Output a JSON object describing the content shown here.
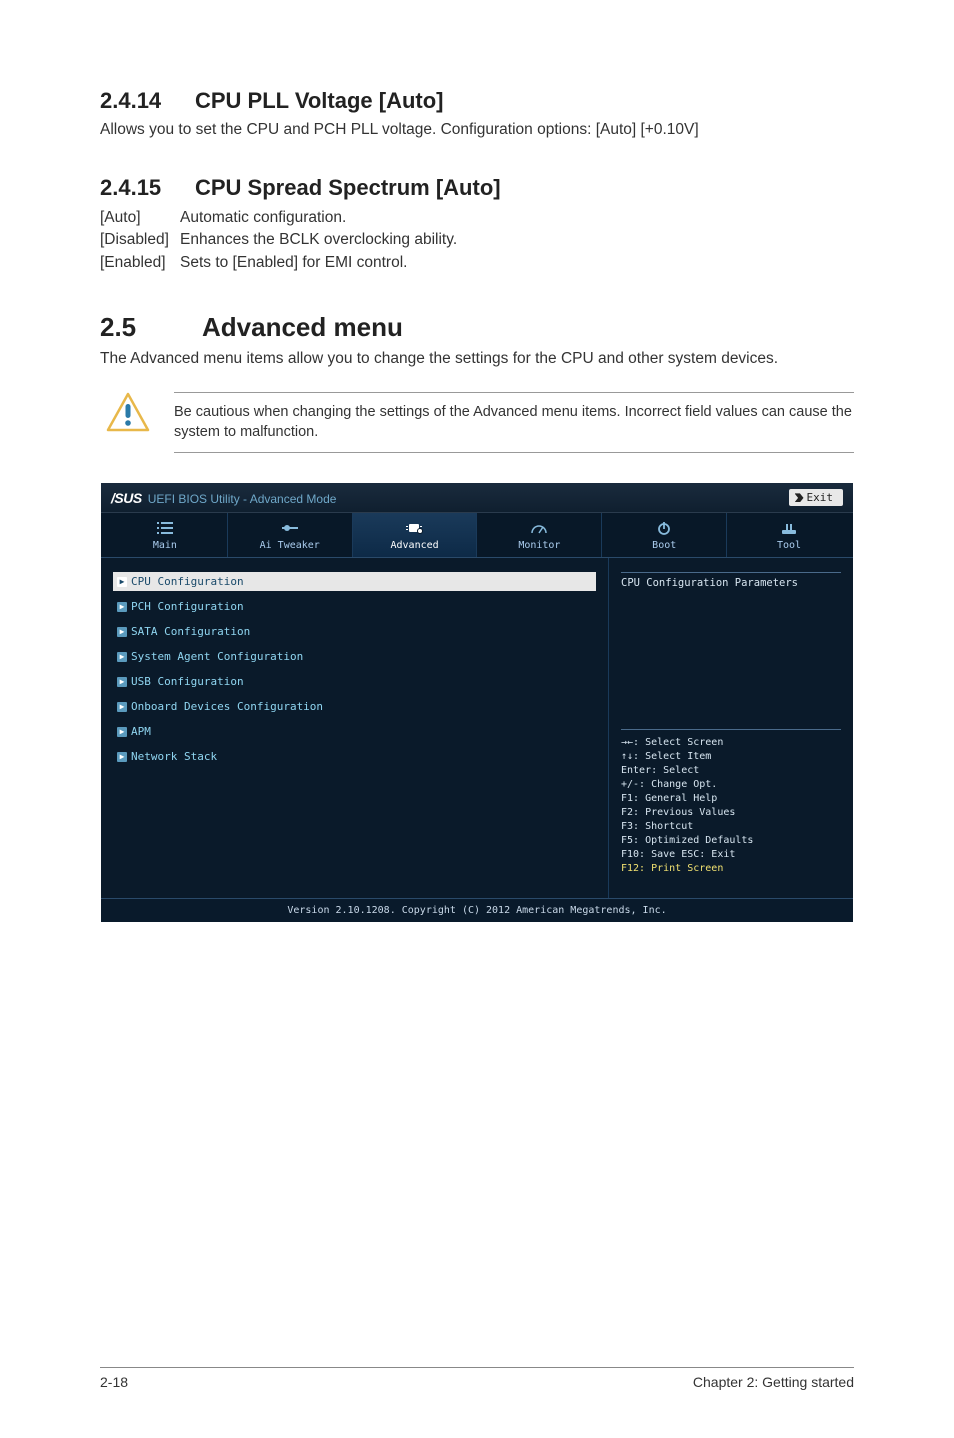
{
  "section_2414": {
    "num": "2.4.14",
    "title": "CPU PLL Voltage [Auto]",
    "desc": "Allows you to set the CPU and PCH PLL voltage. Configuration options: [Auto] [+0.10V]"
  },
  "section_2415": {
    "num": "2.4.15",
    "title": "CPU Spread Spectrum [Auto]",
    "options": [
      {
        "key": "[Auto]",
        "val": "Automatic configuration."
      },
      {
        "key": "[Disabled]",
        "val": "Enhances the BCLK overclocking ability."
      },
      {
        "key": "[Enabled]",
        "val": "Sets to [Enabled] for EMI control."
      }
    ]
  },
  "section_25": {
    "num": "2.5",
    "title": "Advanced menu",
    "desc": "The Advanced menu items allow you to change the settings for the CPU and other system devices."
  },
  "callout": {
    "text": "Be cautious when changing the settings of the Advanced menu items. Incorrect field values can cause the system to malfunction."
  },
  "bios": {
    "logo": "/SUS",
    "title_rest": "UEFI BIOS Utility - Advanced Mode",
    "exit": "Exit",
    "tabs": [
      {
        "label": "Main"
      },
      {
        "label": "Ai Tweaker"
      },
      {
        "label": "Advanced"
      },
      {
        "label": "Monitor"
      },
      {
        "label": "Boot"
      },
      {
        "label": "Tool"
      }
    ],
    "items": [
      "CPU Configuration",
      "PCH Configuration",
      "SATA Configuration",
      "System Agent Configuration",
      "USB Configuration",
      "Onboard Devices Configuration",
      "APM",
      "Network Stack"
    ],
    "help_title": "CPU Configuration Parameters",
    "shortcuts": [
      "→←: Select Screen",
      "↑↓: Select Item",
      "Enter: Select",
      "+/-: Change Opt.",
      "F1: General Help",
      "F2: Previous Values",
      "F3: Shortcut",
      "F5: Optimized Defaults",
      "F10: Save  ESC: Exit",
      "F12: Print Screen"
    ],
    "footer": "Version 2.10.1208. Copyright (C) 2012 American Megatrends, Inc."
  },
  "footer": {
    "left": "2-18",
    "right": "Chapter 2: Getting started"
  }
}
